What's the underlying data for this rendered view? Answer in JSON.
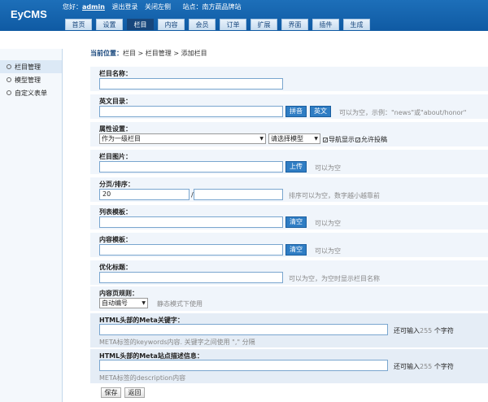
{
  "header": {
    "logo": "EyCMS",
    "greeting": "您好：",
    "username": "admin",
    "logout": "退出登录",
    "close_left": "关闭左侧",
    "site": "站点：南方蔬品牌站"
  },
  "nav": {
    "tabs": [
      "首页",
      "设置",
      "栏目",
      "内容",
      "会员",
      "订单",
      "扩展",
      "界面",
      "插件",
      "生成"
    ],
    "active": 2
  },
  "sidebar": {
    "items": [
      "栏目管理",
      "模型管理",
      "自定义表单"
    ],
    "active": 0
  },
  "breadcrumb": {
    "label": "当前位置：",
    "path": "栏目 > 栏目管理 > 添加栏目"
  },
  "form": {
    "name": {
      "title": "栏目名称：",
      "value": ""
    },
    "dir": {
      "title": "英文目录：",
      "value": "",
      "pinyin_btn": "拼音",
      "english_btn": "英文",
      "hint": "可以为空，示例：\"news\"或\"about/honor\""
    },
    "attr": {
      "title": "属性设置：",
      "parent": "作为一级栏目",
      "model": "请选择模型",
      "nav_show": "导航显示",
      "allow_post": "允许投稿"
    },
    "image": {
      "title": "栏目图片：",
      "value": "",
      "upload_btn": "上传",
      "hint": "可以为空"
    },
    "page": {
      "title": "分页/排序：",
      "pagesize": "20",
      "sep": "/",
      "sort": "",
      "hint": "排序可以为空，数字越小越靠前"
    },
    "list_tpl": {
      "title": "列表模板：",
      "value": "",
      "clear_btn": "清空",
      "hint": "可以为空"
    },
    "content_tpl": {
      "title": "内容模板：",
      "value": "",
      "clear_btn": "清空",
      "hint": "可以为空"
    },
    "seo_title": {
      "title": "优化标题：",
      "value": "",
      "hint": "可以为空，为空时显示栏目名称"
    },
    "rule": {
      "title": "内容页规则：",
      "value": "自动编号",
      "hint": "静态模式下使用"
    },
    "keywords": {
      "title": "HTML头部的Meta关键字：",
      "value": "",
      "count_pre": "还可输入",
      "count": "255",
      "count_post": "个字符",
      "note": "META标签的keywords内容. 关键字之间使用 \",\" 分隔"
    },
    "desc": {
      "title": "HTML头部的Meta站点描述信息：",
      "value": "",
      "count_pre": "还可输入",
      "count": "255",
      "count_post": "个字符",
      "note": "META标签的description内容"
    },
    "save_btn": "保存",
    "back_btn": "返回"
  },
  "colors": {
    "header": "#1d6fb9",
    "nav_active": "#17467c",
    "button": "#2f7dc4",
    "section_bg": "#f0f5fb"
  }
}
